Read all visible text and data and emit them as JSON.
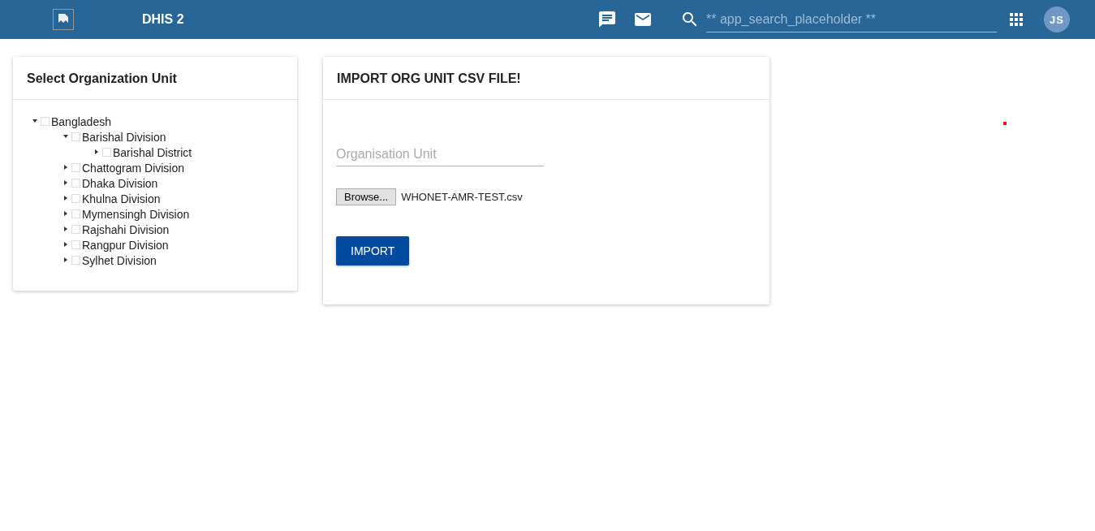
{
  "header": {
    "title": "DHIS 2",
    "search": {
      "placeholder": "** app_search_placeholder **"
    },
    "avatar": "JS"
  },
  "org_panel": {
    "title": "Select Organization Unit",
    "tree": [
      {
        "label": "Bangladesh",
        "expanded": true,
        "checked": false,
        "children": [
          {
            "label": "Barishal Division",
            "expanded": true,
            "checked": false,
            "children": [
              {
                "label": "Barishal District",
                "expanded": false,
                "checked": false
              }
            ]
          },
          {
            "label": "Chattogram Division",
            "expanded": false,
            "checked": false
          },
          {
            "label": "Dhaka Division",
            "expanded": false,
            "checked": false
          },
          {
            "label": "Khulna Division",
            "expanded": false,
            "checked": false
          },
          {
            "label": "Mymensingh Division",
            "expanded": false,
            "checked": false
          },
          {
            "label": "Rajshahi Division",
            "expanded": false,
            "checked": false
          },
          {
            "label": "Rangpur Division",
            "expanded": false,
            "checked": false
          },
          {
            "label": "Sylhet Division",
            "expanded": false,
            "checked": false
          }
        ]
      }
    ]
  },
  "import_panel": {
    "title": "IMPORT ORG UNIT CSV FILE!",
    "org_unit_field": {
      "placeholder": "Organisation Unit"
    },
    "file": {
      "button": "Browse...",
      "name": "WHONET-AMR-TEST.csv"
    },
    "import_button": "IMPORT"
  }
}
